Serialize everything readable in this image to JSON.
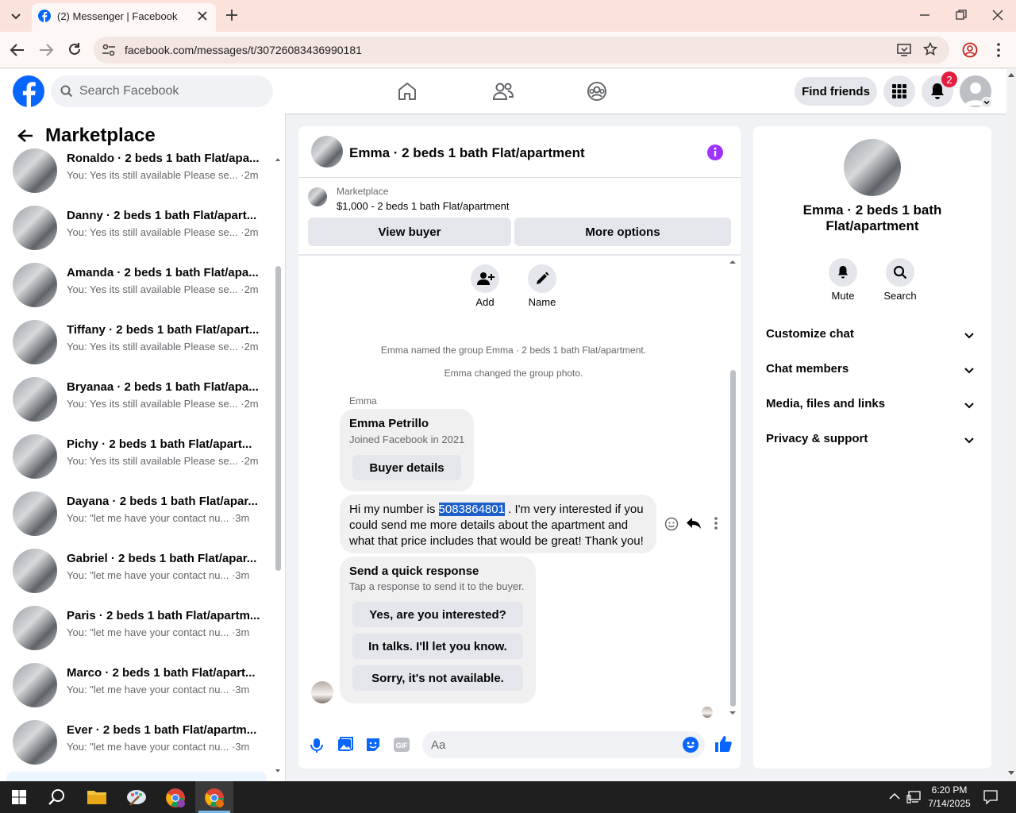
{
  "browser": {
    "tab_title": "(2) Messenger | Facebook",
    "url": "facebook.com/messages/t/30726083436990181"
  },
  "header": {
    "search_placeholder": "Search Facebook",
    "find_friends": "Find friends",
    "notification_count": "2"
  },
  "sidebar": {
    "title": "Marketplace",
    "conversations": [
      {
        "name": "Ronaldo · 2 beds 1 bath Flat/apa...",
        "preview": "You: Yes its still available Please se...",
        "time": "·2m"
      },
      {
        "name": "Danny · 2 beds 1 bath Flat/apart...",
        "preview": "You: Yes its still available Please se...",
        "time": "·2m"
      },
      {
        "name": "Amanda · 2 beds 1 bath Flat/apa...",
        "preview": "You: Yes its still available Please se...",
        "time": "·2m"
      },
      {
        "name": "Tiffany · 2 beds 1 bath Flat/apart...",
        "preview": "You: Yes its still available Please se...",
        "time": "·2m"
      },
      {
        "name": "Bryanaa · 2 beds 1 bath Flat/apa...",
        "preview": "You: Yes its still available Please se...",
        "time": "·2m"
      },
      {
        "name": "Pichy · 2 beds 1 bath Flat/apart...",
        "preview": "You: Yes its still available Please se...",
        "time": "·2m"
      },
      {
        "name": "Dayana · 2 beds 1 bath Flat/apar...",
        "preview": "You: \"let me have your contact nu...",
        "time": "·3m"
      },
      {
        "name": "Gabriel · 2 beds 1 bath Flat/apar...",
        "preview": "You: \"let me have your contact nu...",
        "time": "·3m"
      },
      {
        "name": "Paris · 2 beds 1 bath Flat/apartm...",
        "preview": "You: \"let me have your contact nu...",
        "time": "·3m"
      },
      {
        "name": "Marco · 2 beds 1 bath Flat/apart...",
        "preview": "You: \"let me have your contact nu...",
        "time": "·3m"
      },
      {
        "name": "Ever · 2 beds 1 bath Flat/apartm...",
        "preview": "You: \"let me have your contact nu...",
        "time": "·3m"
      }
    ]
  },
  "chat": {
    "title": "Emma · 2 beds 1 bath Flat/apartment",
    "listing_source": "Marketplace",
    "listing_detail": "$1,000 - 2 beds 1 bath Flat/apartment",
    "view_buyer": "View buyer",
    "more_options": "More options",
    "add_label": "Add",
    "name_label": "Name",
    "event1": "Emma named the group Emma · 2 beds 1 bath Flat/apartment.",
    "event2": "Emma changed the group photo.",
    "sender": "Emma",
    "card_name": "Emma Petrillo",
    "card_joined": "Joined Facebook in 2021",
    "buyer_details": "Buyer details",
    "message_prefix": "Hi my number is ",
    "message_number": "5083864801",
    "message_line1_rest": " . I'm very interested if you",
    "message_line2": "could send me more details about the apartment and",
    "message_line3": "what that price includes that would be great! Thank you!",
    "quick_title": "Send a quick response",
    "quick_sub": "Tap a response to send it to the buyer.",
    "quick_replies": [
      "Yes, are you interested?",
      "In talks. I'll let you know.",
      "Sorry, it's not available."
    ],
    "composer_placeholder": "Aa"
  },
  "info": {
    "title": "Emma · 2 beds 1 bath Flat/apartment",
    "mute": "Mute",
    "search": "Search",
    "sections": [
      "Customize chat",
      "Chat members",
      "Media, files and links",
      "Privacy & support"
    ]
  },
  "taskbar": {
    "time": "6:20 PM",
    "date": "7/14/2025"
  },
  "colors": {
    "fb_blue": "#0866ff",
    "purple_info": "#a033ff",
    "badge_red": "#e41e3f",
    "highlight": "#1a5fcc"
  }
}
